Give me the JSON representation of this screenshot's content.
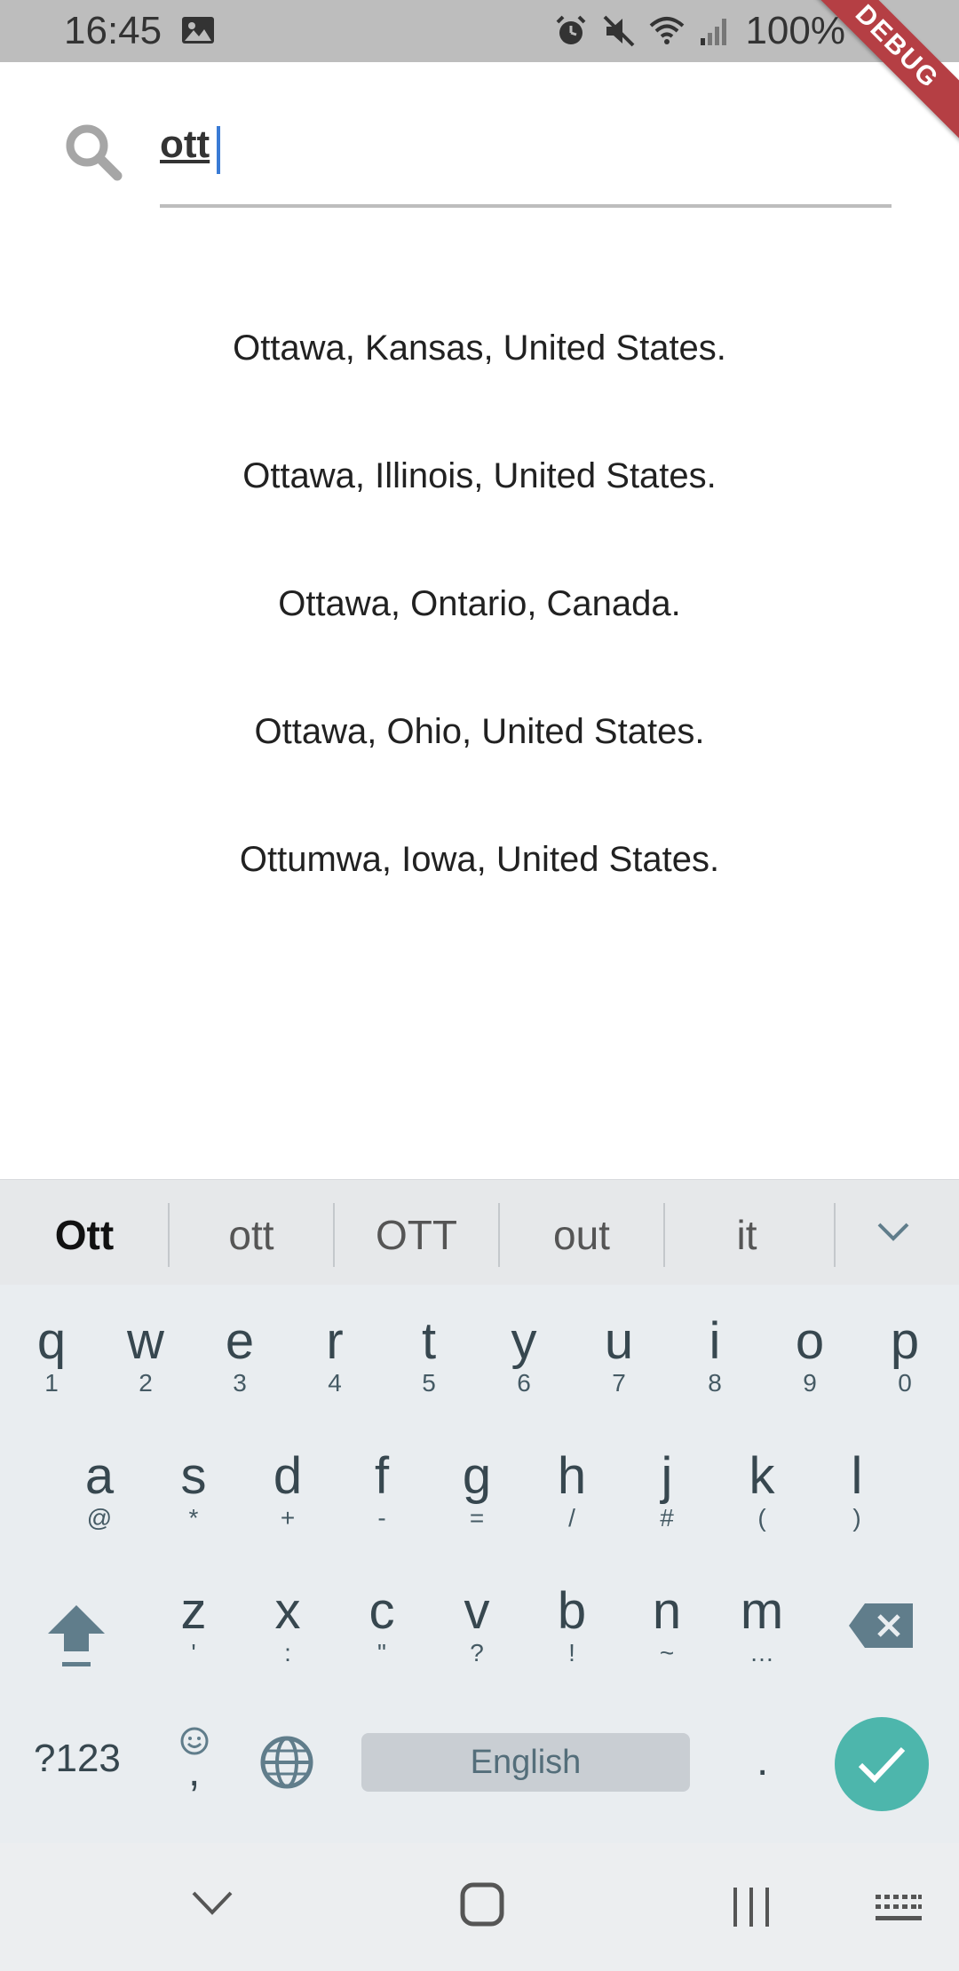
{
  "status_bar": {
    "time": "16:45",
    "battery": "100%",
    "icons": [
      "gallery-icon",
      "alarm-icon",
      "mute-icon",
      "wifi-icon",
      "signal-icon",
      "battery-icon"
    ],
    "debug_label": "DEBUG"
  },
  "search": {
    "value": "ott",
    "icon": "search-icon"
  },
  "results": [
    "Ottawa, Kansas, United States.",
    "Ottawa, Illinois, United States.",
    "Ottawa, Ontario, Canada.",
    "Ottawa, Ohio, United States.",
    "Ottumwa, Iowa, United States."
  ],
  "keyboard": {
    "suggestions": [
      "Ott",
      "ott",
      "OTT",
      "out",
      "it"
    ],
    "row1": [
      {
        "k": "q",
        "s": "1"
      },
      {
        "k": "w",
        "s": "2"
      },
      {
        "k": "e",
        "s": "3"
      },
      {
        "k": "r",
        "s": "4"
      },
      {
        "k": "t",
        "s": "5"
      },
      {
        "k": "y",
        "s": "6"
      },
      {
        "k": "u",
        "s": "7"
      },
      {
        "k": "i",
        "s": "8"
      },
      {
        "k": "o",
        "s": "9"
      },
      {
        "k": "p",
        "s": "0"
      }
    ],
    "row2": [
      {
        "k": "a",
        "s": "@"
      },
      {
        "k": "s",
        "s": "*"
      },
      {
        "k": "d",
        "s": "+"
      },
      {
        "k": "f",
        "s": "-"
      },
      {
        "k": "g",
        "s": "="
      },
      {
        "k": "h",
        "s": "/"
      },
      {
        "k": "j",
        "s": "#"
      },
      {
        "k": "k",
        "s": "("
      },
      {
        "k": "l",
        "s": ")"
      }
    ],
    "row3": [
      {
        "k": "z",
        "s": "'"
      },
      {
        "k": "x",
        "s": ":"
      },
      {
        "k": "c",
        "s": "\""
      },
      {
        "k": "v",
        "s": "?"
      },
      {
        "k": "b",
        "s": "!"
      },
      {
        "k": "n",
        "s": "~"
      },
      {
        "k": "m",
        "s": "…"
      }
    ],
    "symbols_label": "?123",
    "comma": ",",
    "period": ".",
    "space_label": "English"
  },
  "colors": {
    "accent": "#4db6ac",
    "caret": "#3a7bd5",
    "debug_ribbon": "#b53f44"
  }
}
